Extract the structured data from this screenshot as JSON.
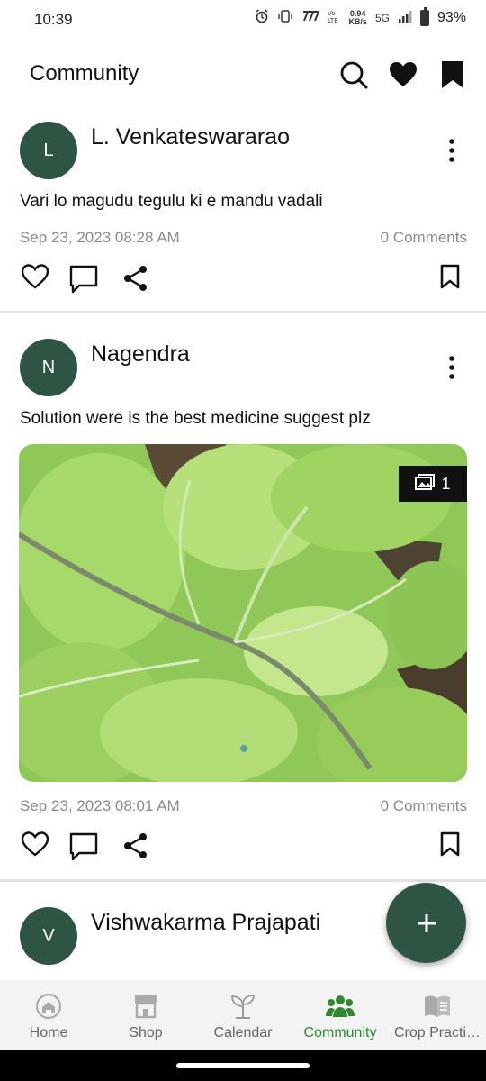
{
  "status": {
    "time": "10:39",
    "network_speed_top": "0.94",
    "network_speed_bottom": "KB/s",
    "signal_label": "5G",
    "battery": "93%"
  },
  "header": {
    "title": "Community",
    "icons": [
      "search-icon",
      "heart-icon",
      "bookmark-icon"
    ]
  },
  "posts": [
    {
      "avatar_letter": "L",
      "author": "L. Venkateswararao",
      "text": "Vari lo magudu tegulu ki e mandu vadali",
      "date": "Sep 23, 2023 08:28 AM",
      "comments": "0 Comments"
    },
    {
      "avatar_letter": "N",
      "author": "Nagendra",
      "text": "Solution were is the best medicine suggest plz",
      "image_count": "1",
      "date": "Sep 23, 2023 08:01 AM",
      "comments": "0 Comments"
    },
    {
      "avatar_letter": "V",
      "author": "Vishwakarma Prajapati"
    }
  ],
  "fab": {
    "icon": "plus-icon"
  },
  "nav": [
    {
      "label": "Home",
      "icon": "home-icon"
    },
    {
      "label": "Shop",
      "icon": "shop-icon"
    },
    {
      "label": "Calendar",
      "icon": "sprout-icon"
    },
    {
      "label": "Community",
      "icon": "community-icon",
      "active": true
    },
    {
      "label": "Crop Practi…",
      "icon": "book-icon"
    }
  ],
  "colors": {
    "accent": "#2e5443",
    "active_nav": "#2f8a2f",
    "muted_text": "#8a8a8a"
  }
}
